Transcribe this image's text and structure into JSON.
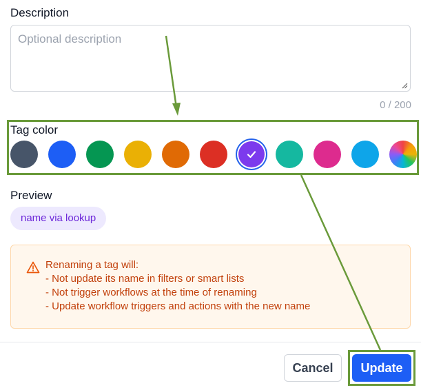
{
  "description": {
    "label": "Description",
    "placeholder": "Optional description",
    "value": "",
    "counter": "0 / 200"
  },
  "tag_color": {
    "label": "Tag color",
    "selected_index": 6,
    "swatches": [
      {
        "name": "slate",
        "color": "#475569"
      },
      {
        "name": "blue",
        "color": "#1d5ef5"
      },
      {
        "name": "green",
        "color": "#059652"
      },
      {
        "name": "amber",
        "color": "#eab005"
      },
      {
        "name": "orange",
        "color": "#e06a05"
      },
      {
        "name": "red",
        "color": "#dc2f24"
      },
      {
        "name": "purple",
        "color": "#7c3aed"
      },
      {
        "name": "teal",
        "color": "#15b8a0"
      },
      {
        "name": "pink",
        "color": "#dd2b8e"
      },
      {
        "name": "sky",
        "color": "#0ea5e9"
      },
      {
        "name": "rainbow",
        "color": "conic-gradient"
      }
    ]
  },
  "preview": {
    "label": "Preview",
    "chip_text": "name via lookup"
  },
  "warning": {
    "icon": "warning-triangle-icon",
    "lines": [
      "Renaming a tag will:",
      "- Not update its name in filters or smart lists",
      "- Not trigger workflows at the time of renaming",
      "- Update workflow triggers and actions with the new name"
    ]
  },
  "footer": {
    "cancel_label": "Cancel",
    "update_label": "Update"
  },
  "colors": {
    "annotation": "#6a9a3a",
    "primary": "#1d5ef5",
    "warning_text": "#c2410c",
    "warning_bg": "#fff7ed",
    "chip_bg": "#ede9fe",
    "chip_text": "#6d28d9"
  }
}
